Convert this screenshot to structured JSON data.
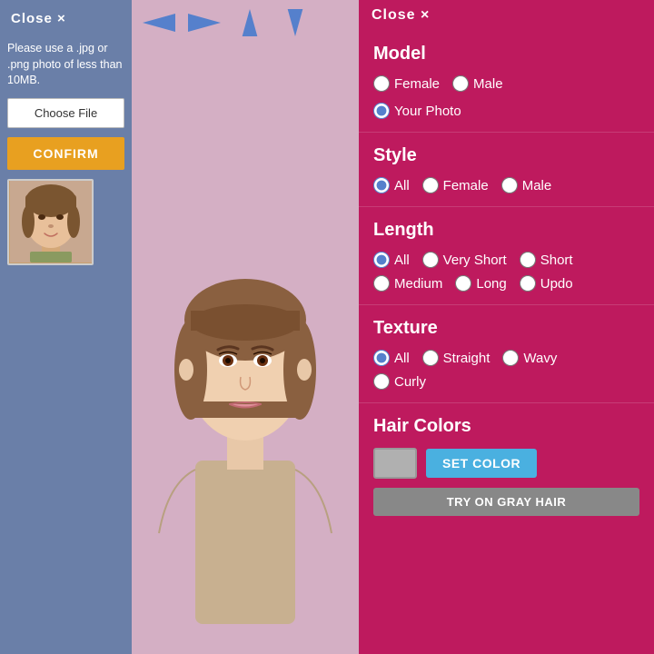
{
  "sidebar": {
    "close_label": "Close ×",
    "info_text": "Please use a .jpg or .png photo of less than 10MB.",
    "choose_file_label": "Choose File",
    "confirm_label": "CONFIRM"
  },
  "nav": {
    "left_arrow": "←",
    "right_arrow": "→",
    "up_arrow": "↑",
    "down_arrow": "↓"
  },
  "right_panel": {
    "close_label": "Close ×",
    "model_section": {
      "title": "Model",
      "options": [
        {
          "id": "female",
          "label": "Female",
          "checked": false
        },
        {
          "id": "male",
          "label": "Male",
          "checked": false
        },
        {
          "id": "your-photo",
          "label": "Your Photo",
          "checked": true
        }
      ]
    },
    "style_section": {
      "title": "Style",
      "options": [
        {
          "id": "all-style",
          "label": "All",
          "checked": true
        },
        {
          "id": "female-style",
          "label": "Female",
          "checked": false
        },
        {
          "id": "male-style",
          "label": "Male",
          "checked": false
        }
      ]
    },
    "length_section": {
      "title": "Length",
      "options_row1": [
        {
          "id": "all-length",
          "label": "All",
          "checked": true
        },
        {
          "id": "very-short",
          "label": "Very Short",
          "checked": false
        },
        {
          "id": "short",
          "label": "Short",
          "checked": false
        }
      ],
      "options_row2": [
        {
          "id": "medium",
          "label": "Medium",
          "checked": false
        },
        {
          "id": "long",
          "label": "Long",
          "checked": false
        },
        {
          "id": "updo",
          "label": "Updo",
          "checked": false
        }
      ]
    },
    "texture_section": {
      "title": "Texture",
      "options_row1": [
        {
          "id": "all-texture",
          "label": "All",
          "checked": true
        },
        {
          "id": "straight",
          "label": "Straight",
          "checked": false
        },
        {
          "id": "wavy",
          "label": "Wavy",
          "checked": false
        }
      ],
      "options_row2": [
        {
          "id": "curly",
          "label": "Curly",
          "checked": false
        }
      ]
    },
    "hair_colors": {
      "title": "Hair Colors",
      "set_color_label": "SET COLOR",
      "try_gray_label": "TRY ON GRAY HAIR"
    }
  }
}
